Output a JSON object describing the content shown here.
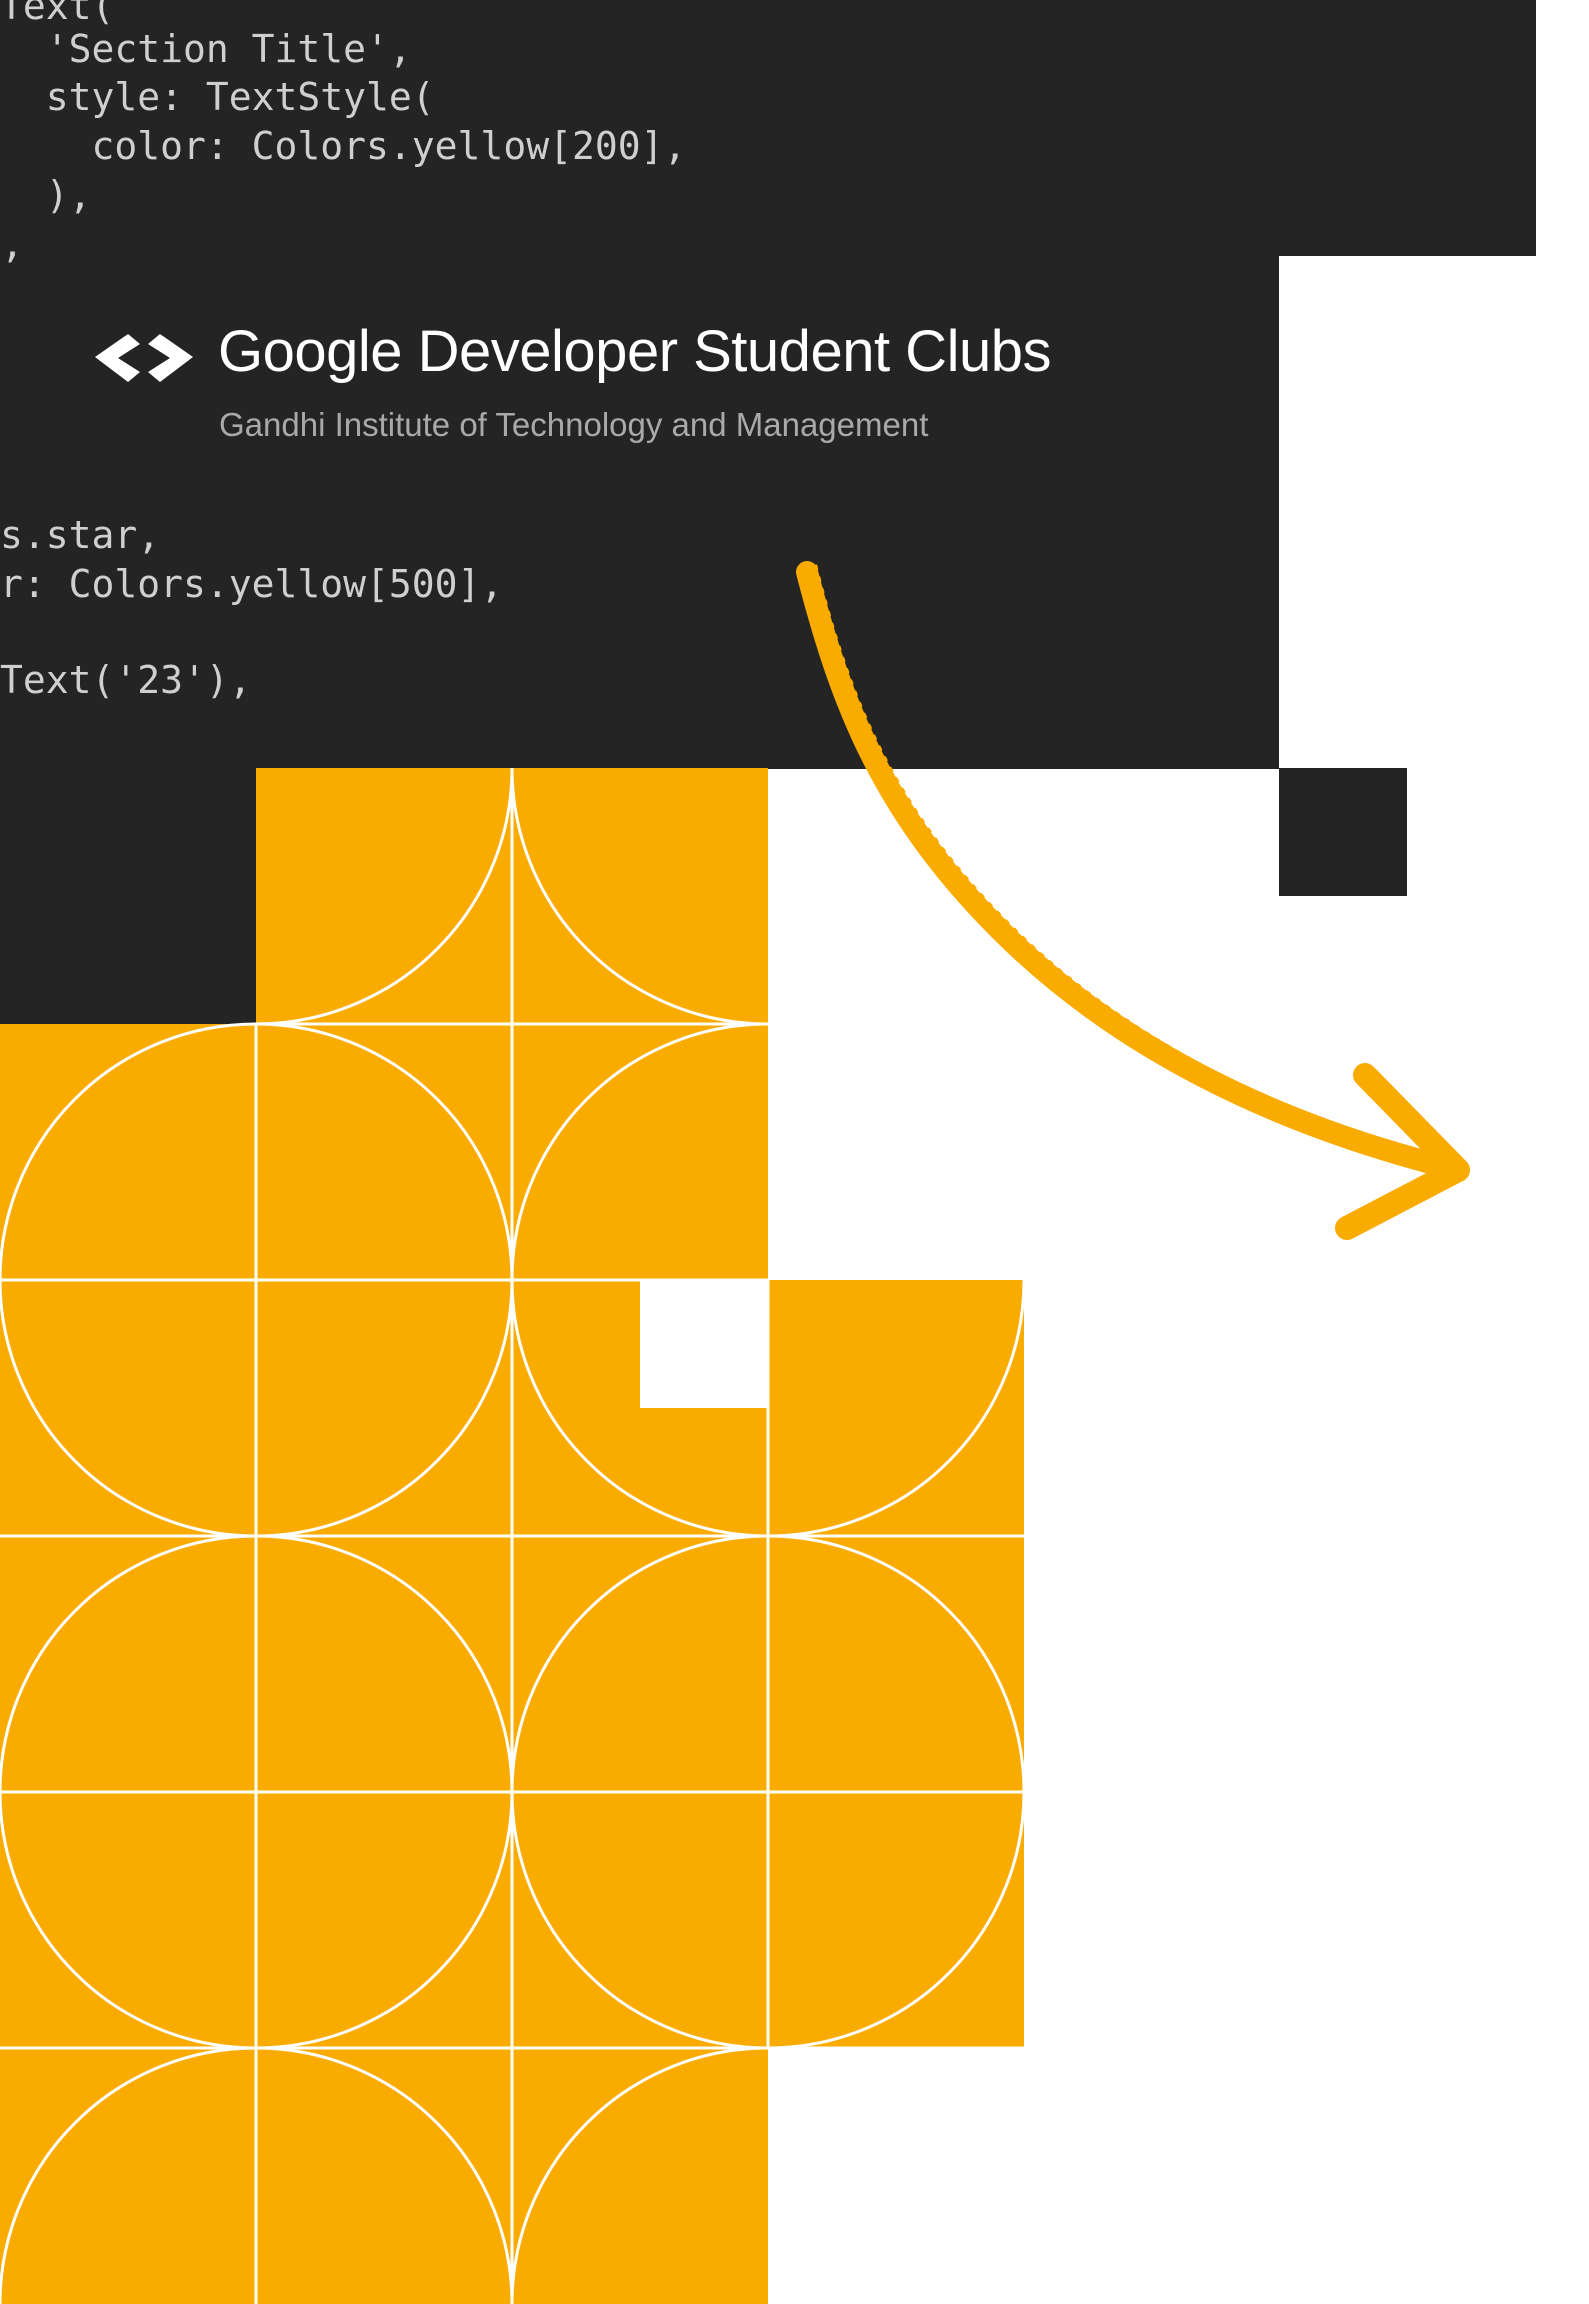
{
  "brand": {
    "title": "Google Developer Student Clubs",
    "subtitle": "Gandhi Institute of Technology and Management",
    "logo_icon": "gdsc-brackets-logo-icon"
  },
  "code_snippet": {
    "lines": [
      "Text(",
      "  'Section Title',",
      "  style: TextStyle(",
      "    color: Colors.yellow[200],",
      "  ),",
      "),",
      "s.star,",
      "r: Colors.yellow[500],",
      "Text('23'),"
    ]
  },
  "decor": {
    "arrow_icon": "hand-drawn-arrow-icon",
    "pattern": "quarter-circle-tile-pattern"
  },
  "colors": {
    "dark_panel": "#242424",
    "accent_yellow": "#F9AB00",
    "tile_line": "#ffffff",
    "code_text": "#cfcfcf",
    "subtitle_text": "#a9a9a9"
  }
}
